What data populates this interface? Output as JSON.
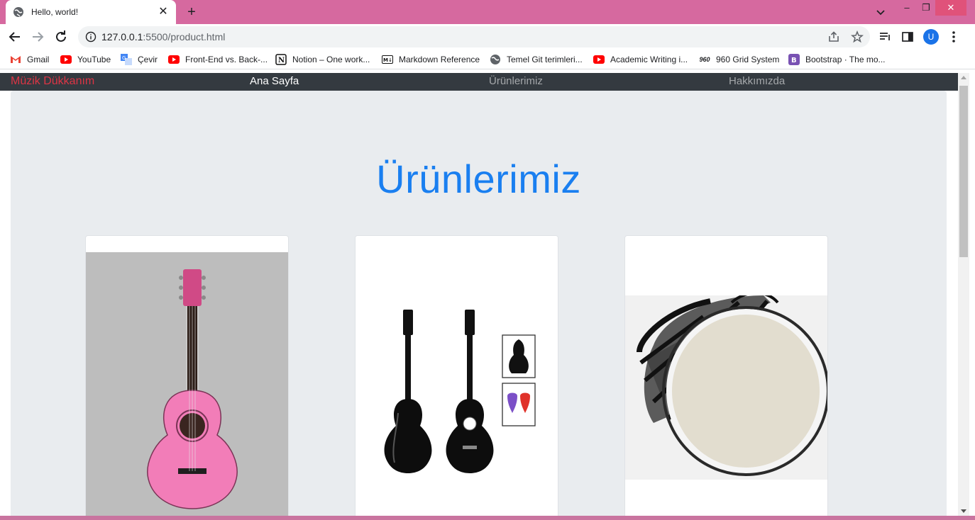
{
  "browser": {
    "tab_title": "Hello, world!",
    "url_host": "127.0.0.1",
    "url_rest": ":5500/product.html",
    "avatar_letter": "U"
  },
  "bookmarks": [
    {
      "label": "Gmail",
      "icon": "gmail-icon"
    },
    {
      "label": "YouTube",
      "icon": "youtube-icon"
    },
    {
      "label": "Çevir",
      "icon": "translate-icon"
    },
    {
      "label": "Front-End vs. Back-...",
      "icon": "youtube-icon"
    },
    {
      "label": "Notion – One work...",
      "icon": "notion-icon"
    },
    {
      "label": "Markdown Reference",
      "icon": "markdown-icon"
    },
    {
      "label": "Temel Git terimleri...",
      "icon": "globe-icon"
    },
    {
      "label": "Academic Writing i...",
      "icon": "youtube-icon"
    },
    {
      "label": "960 Grid System",
      "icon": "grid960-icon"
    },
    {
      "label": "Bootstrap · The mo...",
      "icon": "bootstrap-icon"
    }
  ],
  "navbar": {
    "brand": "Müzik Dükkanım",
    "links": [
      "Ana Sayfa",
      "Ürünlerimiz",
      "Hakkımızda"
    ]
  },
  "page": {
    "title": "Ürünlerimiz"
  },
  "products": [
    {
      "image": "pink-classical-guitar"
    },
    {
      "image": "black-classical-guitar-set"
    },
    {
      "image": "davul-drum"
    }
  ],
  "colors": {
    "tab_strip": "#d6699f",
    "navbar_bg": "#343a40",
    "brand": "#dc3545",
    "title": "#1a7ff0",
    "jumbotron": "#e9ecef"
  }
}
